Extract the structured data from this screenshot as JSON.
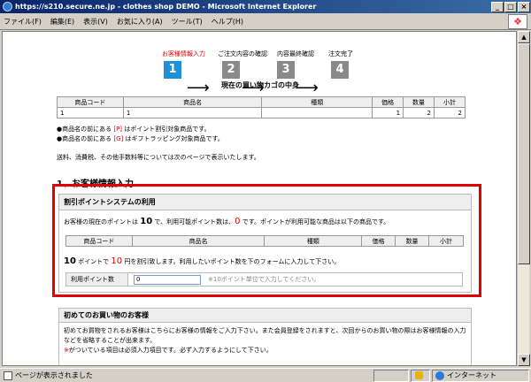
{
  "window": {
    "title": "https://s210.secure.ne.jp - clothes shop DEMO - Microsoft Internet Explorer"
  },
  "menu": [
    "ファイル(F)",
    "編集(E)",
    "表示(V)",
    "お気に入り(A)",
    "ツール(T)",
    "ヘルプ(H)"
  ],
  "steps": [
    {
      "label": "お客様情報入力",
      "num": "1",
      "color": "#1e90d8"
    },
    {
      "label": "ご注文内容の確認",
      "num": "2",
      "color": "#8a8a8a"
    },
    {
      "label": "内容最終確認",
      "num": "3",
      "color": "#8a8a8a"
    },
    {
      "label": "注文完了",
      "num": "4",
      "color": "#8a8a8a"
    }
  ],
  "cart": {
    "title": "現在の買い物カゴの中身",
    "headers": [
      "商品コード",
      "商品名",
      "種類",
      "価格",
      "数量",
      "小計"
    ],
    "row": [
      "1",
      "1",
      "",
      "1",
      "2",
      "2"
    ]
  },
  "notes": {
    "line1_pre": "●商品名の前にある ",
    "line1_mark": "[P]",
    "line1_post": " はポイント割引対象商品です。",
    "line2_pre": "●商品名の前にある ",
    "line2_mark": "[G]",
    "line2_post": " はギフトラッピング対象商品です。"
  },
  "shipping_text": "送料、消費税、その他手数料等については次のページで表示いたします。",
  "section_heading": "1、お客様情報入力",
  "points": {
    "heading": "割引ポイントシステムの利用",
    "line1_a": "お客様の現在のポイントは ",
    "line1_pts": "10",
    "line1_b": " で、利用可能ポイント数は、",
    "line1_avail": "0",
    "line1_c": " です。ポイントが利用可能な商品は以下の商品です。",
    "headers": [
      "商品コード",
      "商品名",
      "種類",
      "価格",
      "数量",
      "小計"
    ],
    "line2_pts": "10",
    "line2_a": " ポイントで ",
    "line2_yen": "10",
    "line2_b": " 円を割引致します。利用したいポイント数を下のフォームに入力して下さい。",
    "field_label": "利用ポイント数",
    "field_value": "0",
    "field_hint": "※10ポイント単位で入力してください。"
  },
  "first_time": {
    "heading": "初めてのお買い物のお客様",
    "text1": "初めてお買物をされるお客様はこちらにお客様の情報をご入力下さい。また会員登録をされますと、次回からのお買い物の際はお客様情報の入力などを省略することが出来ます。",
    "text2_mark": "※",
    "text2": "がついている項目は必須入力項目です。必ず入力するようにして下さい。"
  },
  "status": {
    "left": "ページが表示されました",
    "zone": "インターネット"
  }
}
